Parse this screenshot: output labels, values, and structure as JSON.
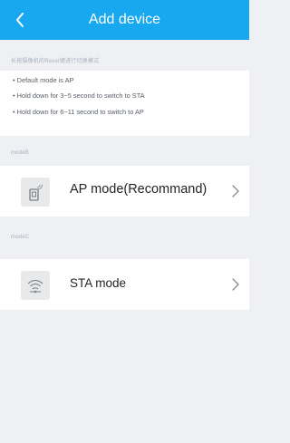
{
  "header": {
    "title": "Add device",
    "background": "#18a8f0"
  },
  "sections": {
    "hint_caption": "长按摄像机的Reset键进行切换模式",
    "mode_b_caption": "modeB",
    "mode_c_caption": "modeC"
  },
  "info": {
    "lines": [
      "• Default mode is AP",
      "• Hold down for 3~5 second to switch to STA",
      "• Hold down for 6~11 second to switch to AP"
    ]
  },
  "modes": [
    {
      "label": "AP mode(Recommand)",
      "icon": "router-device-icon"
    },
    {
      "label": "STA mode",
      "icon": "wifi-icon"
    }
  ]
}
